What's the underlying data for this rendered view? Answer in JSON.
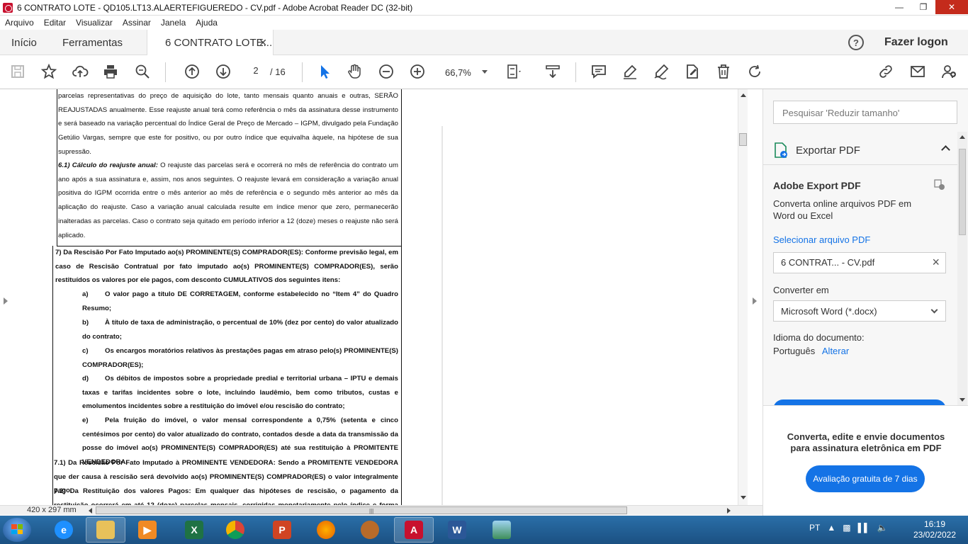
{
  "window": {
    "title": "6 CONTRATO LOTE - QD105.LT13.ALAERTEFIGUEREDO - CV.pdf - Adobe Acrobat Reader DC (32-bit)"
  },
  "menu": [
    "Arquivo",
    "Editar",
    "Visualizar",
    "Assinar",
    "Janela",
    "Ajuda"
  ],
  "tabs": {
    "home": "Início",
    "tools": "Ferramentas",
    "document": "6 CONTRATO LOTE...",
    "login": "Fazer logon"
  },
  "toolbar": {
    "page_current": "2",
    "page_total": "/ 16",
    "zoom": "66,7%"
  },
  "document": {
    "para_6_text": "parcelas representativas do preço de aquisição do lote, tanto mensais quanto anuais e outras, SERÃO REAJUSTADAS anualmente. Esse reajuste anual terá como referência o mês da assinatura desse instrumento e será baseado na variação percentual do Índice Geral de Preço de Mercado – IGPM, divulgado pela Fundação Getúlio Vargas, sempre que este for positivo, ou por outro índice que equivalha àquele, na hipótese de sua supressão.",
    "para_61_label": "6.1) Cálculo do reajuste anual:",
    "para_61_text": " O reajuste das parcelas será e ocorrerá no mês de referência do contrato um ano após a sua assinatura e, assim, nos anos seguintes. O reajuste levará em consideração a variação anual positiva do IGPM ocorrida entre o mês anterior ao mês de referência e o segundo mês anterior ao mês da aplicação do reajuste. Caso a variação anual calculada resulte em índice menor que zero, permanecerão inalteradas as parcelas. Caso o contrato seja quitado em período inferior a 12 (doze) meses o reajuste não será aplicado.",
    "para_7": "7) Da Rescisão Por Fato Imputado ao(s) PROMINENTE(S) COMPRADOR(ES): Conforme previsão legal, em caso de Rescisão Contratual por fato imputado ao(s) PROMINENTE(S) COMPRADOR(ES), serão restituídos os valores por ele pagos, com desconto CUMULATIVOS dos seguintes itens:",
    "items": [
      {
        "letter": "a)",
        "text": "O valor pago a título DE CORRETAGEM, conforme estabelecido no “Item 4” do Quadro Resumo;"
      },
      {
        "letter": "b)",
        "text": "À título de taxa de administração, o percentual de 10% (dez por cento) do valor atualizado do contrato;"
      },
      {
        "letter": "c)",
        "text": "Os encargos moratórios relativos às prestações pagas em atraso pelo(s) PROMINENTE(S) COMPRADOR(ES);"
      },
      {
        "letter": "d)",
        "text": "Os débitos de impostos sobre a propriedade predial e territorial urbana – IPTU e demais taxas e tarifas incidentes sobre o lote, incluindo laudêmio, bem como tributos, custas e emolumentos incidentes sobre a restituição do imóvel e/ou rescisão do contrato;"
      },
      {
        "letter": "e)",
        "text": "Pela fruição do imóvel, o valor mensal correspondente a 0,75% (setenta e cinco centésimos por cento) do valor atualizado do contrato, contados desde a data da transmissão da posse do imóvel ao(s) PROMINENTE(S) COMPRADOR(ES) até sua restituição à PROMITENTE VENDEDORA."
      }
    ],
    "para_71": "7.1) Da Rescisão Por Fato Imputado à PROMINENTE VENDEDORA: Sendo a PROMITENTE VENDEDORA que der causa à rescisão será devolvido ao(s) PROMINENTE(S) COMPRADOR(ES) o valor integralmente pago.",
    "para_72": "7.2) Da Restituição dos valores Pagos: Em qualquer das hipóteses de rescisão, o pagamento da restituição ocorrerá em até 12 (doze) parcelas mensais, corrigidas monetariamente pelo índice e forma contratuais. O"
  },
  "status": {
    "page_size": "420 x 297 mm"
  },
  "right_panel": {
    "search_placeholder": "Pesquisar 'Reduzir tamanho'",
    "export_title": "Exportar PDF",
    "service_title": "Adobe Export PDF",
    "service_desc": "Converta online arquivos PDF em Word ou Excel",
    "select_file": "Selecionar arquivo PDF",
    "file_name": "6 CONTRAT... - CV.pdf",
    "convert_label": "Converter em",
    "convert_value": "Microsoft Word (*.docx)",
    "lang_label": "Idioma do documento:",
    "lang_value": "Português",
    "lang_change": "Alterar",
    "promo": "Converta, edite e envie documentos para assinatura eletrônica em PDF",
    "trial_button": "Avaliação gratuita de 7 dias"
  },
  "taskbar": {
    "lang": "PT",
    "time": "16:19",
    "date": "23/02/2022"
  },
  "colors": {
    "accent": "#1473e6",
    "close_button": "#c42b1c",
    "taskbar": "#1b5082"
  }
}
